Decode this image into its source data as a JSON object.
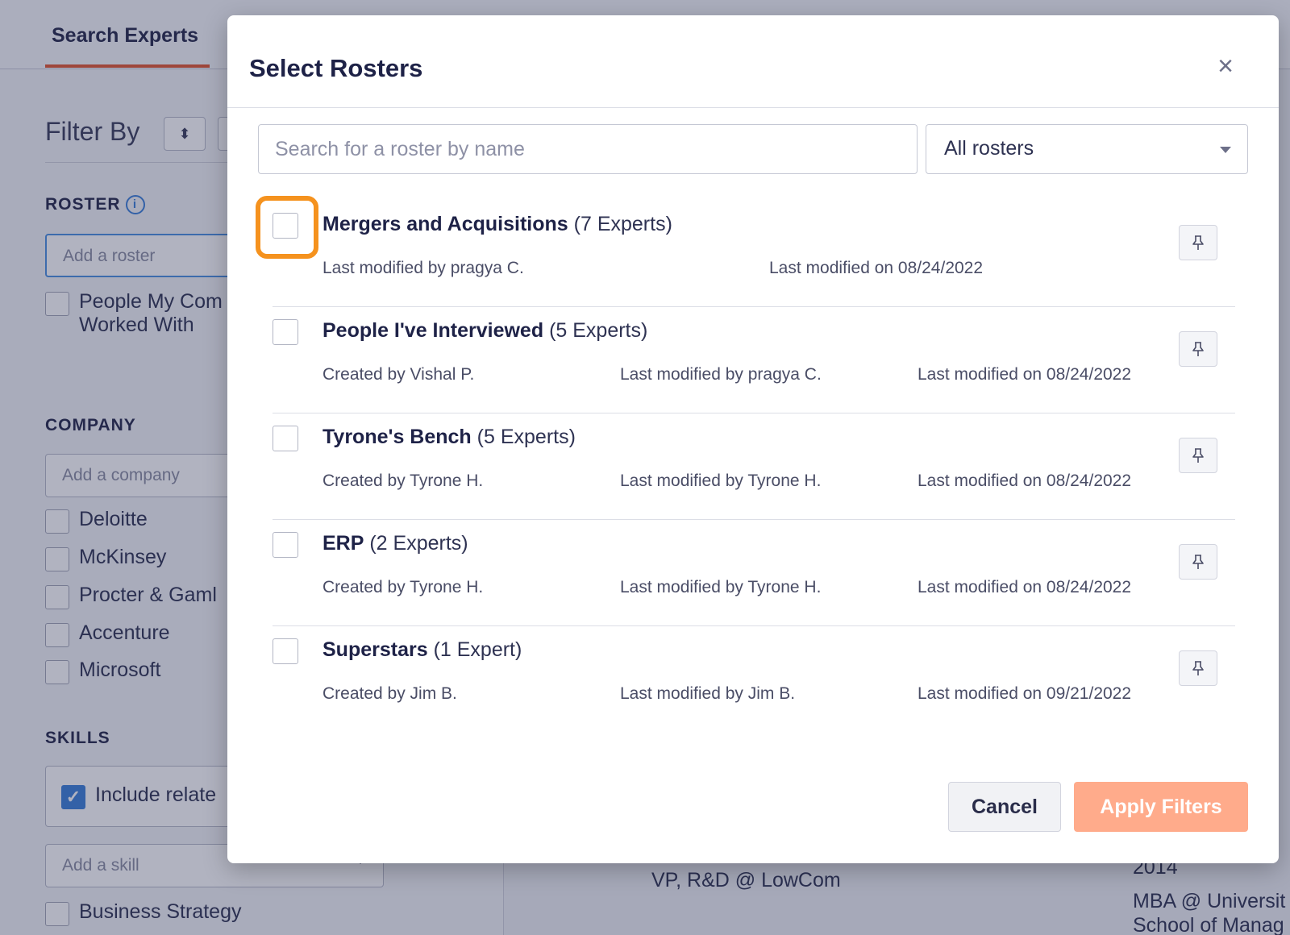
{
  "background": {
    "tab_label": "Search Experts",
    "filter_title": "Filter By",
    "roster_section": "ROSTER",
    "roster_placeholder": "Add a roster",
    "roster_checkbox_line1": "People My Com",
    "roster_checkbox_line2": "Worked With",
    "company_section": "COMPANY",
    "company_placeholder": "Add a company",
    "companies": [
      "Deloitte",
      "McKinsey",
      "Procter & Gaml",
      "Accenture",
      "Microsoft"
    ],
    "skills_section": "SKILLS",
    "include_related_label": "Include relate",
    "skill_placeholder": "Add a skill",
    "skill_item": "Business Strategy",
    "right_snippets": {
      "vp_line": "VP, R&D @ LowCom",
      "year": "2014",
      "mba_line1": "MBA @ Universit",
      "mba_line2": "School of Manag"
    }
  },
  "modal": {
    "title": "Select Rosters",
    "close_symbol": "×",
    "search_placeholder": "Search for a roster by name",
    "filter_select_value": "All rosters",
    "rosters": [
      {
        "name": "Mergers and Acquisitions",
        "count": "(7 Experts)",
        "meta": [
          "Last modified by pragya C.",
          "Last modified on 08/24/2022"
        ]
      },
      {
        "name": "People I've Interviewed",
        "count": "(5 Experts)",
        "meta": [
          "Created by Vishal P.",
          "Last modified by pragya C.",
          "Last modified on 08/24/2022"
        ]
      },
      {
        "name": "Tyrone's Bench",
        "count": "(5 Experts)",
        "meta": [
          "Created by Tyrone H.",
          "Last modified by Tyrone H.",
          "Last modified on 08/24/2022"
        ]
      },
      {
        "name": "ERP",
        "count": "(2 Experts)",
        "meta": [
          "Created by Tyrone H.",
          "Last modified by Tyrone H.",
          "Last modified on 08/24/2022"
        ]
      },
      {
        "name": "Superstars",
        "count": "(1 Expert)",
        "meta": [
          "Created by Jim B.",
          "Last modified by Jim B.",
          "Last modified on 09/21/2022"
        ]
      }
    ],
    "cancel_label": "Cancel",
    "apply_label": "Apply Filters"
  },
  "colors": {
    "accent_tab": "#e2552f",
    "highlight": "#f5921e",
    "apply_button": "#ffab8b",
    "checkbox_checked": "#3b7fd8"
  }
}
